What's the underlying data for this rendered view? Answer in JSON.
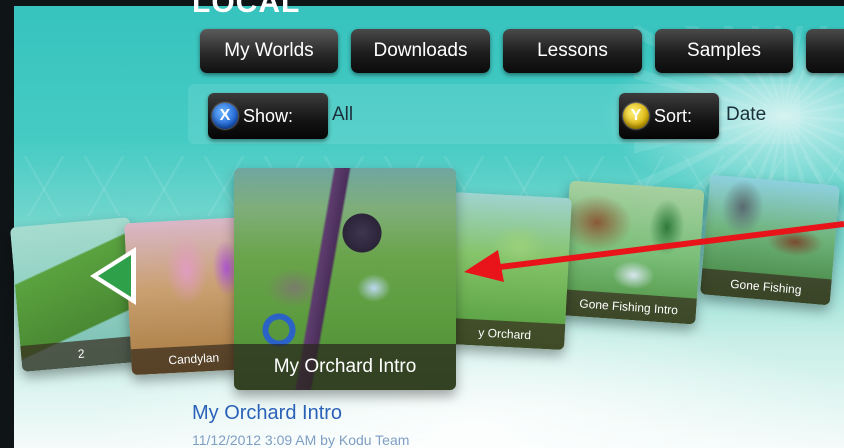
{
  "header": {
    "title": "LOCAL"
  },
  "tabs": [
    {
      "label": "My Worlds"
    },
    {
      "label": "Downloads"
    },
    {
      "label": "Lessons"
    },
    {
      "label": "Samples"
    }
  ],
  "filters": {
    "show": {
      "button_glyph": "X",
      "label": "Show:",
      "value": "All"
    },
    "sort": {
      "button_glyph": "Y",
      "label": "Sort:",
      "value": "Date"
    }
  },
  "carousel": {
    "cards": [
      {
        "label": "2"
      },
      {
        "label": "Candylan"
      },
      {
        "label": "My Orchard Intro"
      },
      {
        "label": "y Orchard"
      },
      {
        "label": "Gone Fishing Intro"
      },
      {
        "label": "Gone Fishing"
      }
    ],
    "prev_icon": "left-arrow-icon"
  },
  "selected": {
    "name": "My Orchard Intro",
    "meta": "11/12/2012 3:09 AM by Kodu Team"
  },
  "annotation": {
    "arrow_icon": "red-pointer-arrow-icon",
    "color": "#e8141a"
  },
  "colors": {
    "tab_bg": "#1c1c1c",
    "accent_x": "#1a5fd1",
    "accent_y": "#d6ad00",
    "selected_name": "#2b62b8"
  }
}
